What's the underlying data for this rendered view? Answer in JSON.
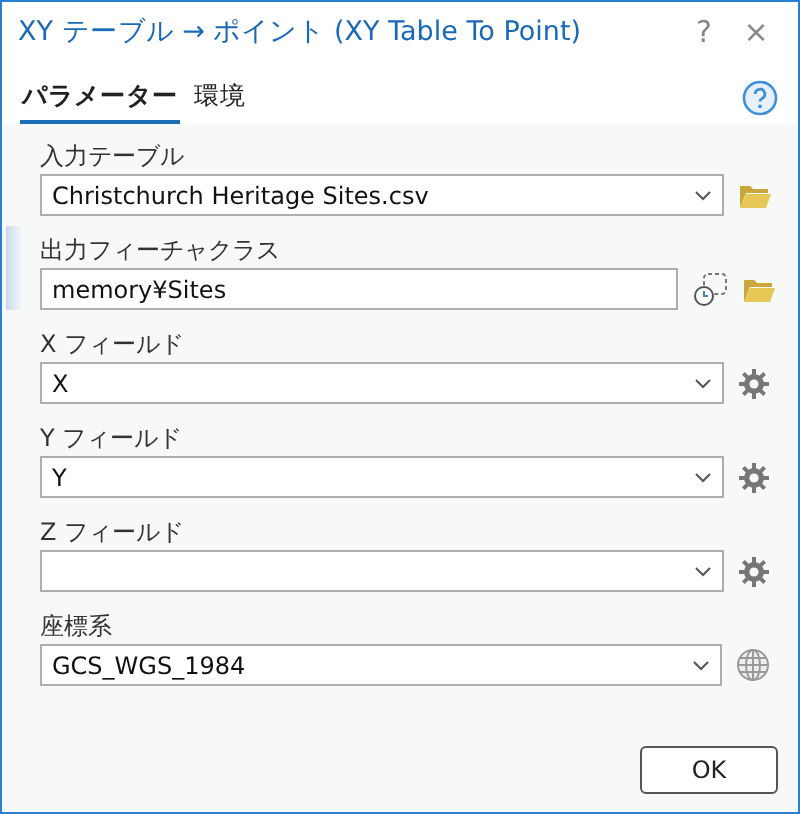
{
  "window": {
    "title": "XY テーブル → ポイント (XY Table To Point)",
    "help_button": "?",
    "close_button": "×"
  },
  "tabs": [
    {
      "label": "パラメーター",
      "selected": true
    },
    {
      "label": "環境",
      "selected": false
    }
  ],
  "params": [
    {
      "kind": "table",
      "label": "入力テーブル",
      "value": "Christchurch Heritage Sites.csv",
      "active": false
    },
    {
      "kind": "output",
      "label": "出力フィーチャクラス",
      "value": "memory¥Sites",
      "active": true
    },
    {
      "kind": "field",
      "label": "X フィールド",
      "value": "X",
      "active": false
    },
    {
      "kind": "field",
      "label": "Y フィールド",
      "value": "Y",
      "active": false
    },
    {
      "kind": "field",
      "label": "Z フィールド",
      "active": false
    },
    {
      "kind": "coords",
      "label": "座標系",
      "value": "GCS_WGS_1984",
      "active": false
    }
  ],
  "buttons": [
    "OK"
  ]
}
